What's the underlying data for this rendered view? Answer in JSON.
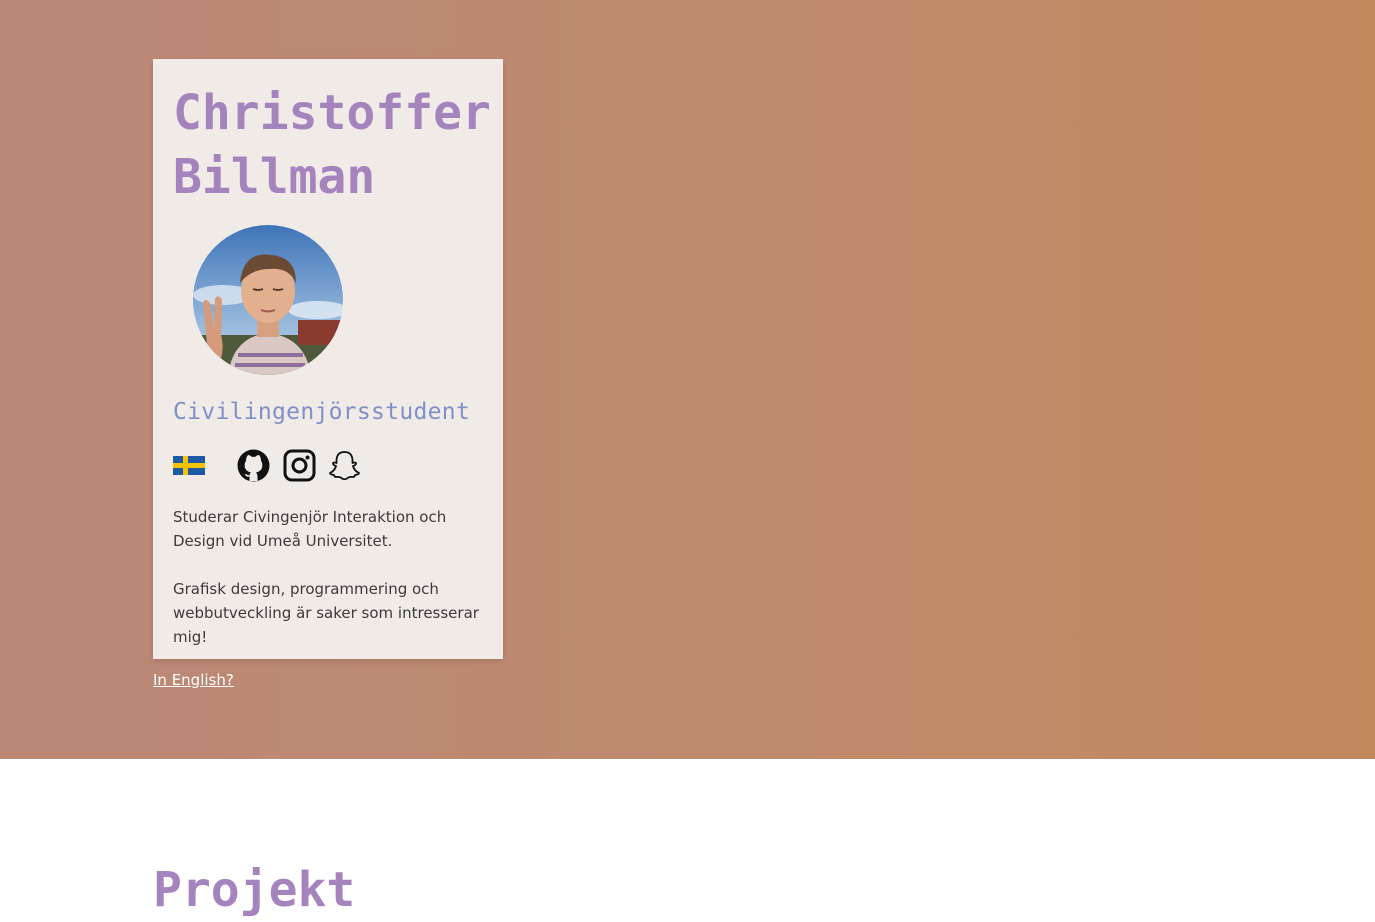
{
  "profile": {
    "first_name": "Christoffer",
    "last_name": "Billman",
    "role": "Civilingenjörsstudent",
    "avatar_icon": "profile-photo"
  },
  "social": {
    "language_flag_icon": "swedish-flag-icon",
    "github_icon": "github-icon",
    "instagram_icon": "instagram-icon",
    "snapchat_icon": "snapchat-icon"
  },
  "description": {
    "paragraph1": "Studerar Civingenjör Interaktion och Design vid Umeå Universitet.",
    "paragraph2": "Grafisk design, programmering och webbutveckling är saker som intresserar mig!"
  },
  "language_link": "In English?",
  "projects": {
    "title": "Projekt"
  },
  "colors": {
    "accent": "#a584bd",
    "role": "#7f8fc9",
    "card": "#f0ebe7",
    "hero_start": "#bb8878",
    "hero_end": "#c2895f"
  }
}
